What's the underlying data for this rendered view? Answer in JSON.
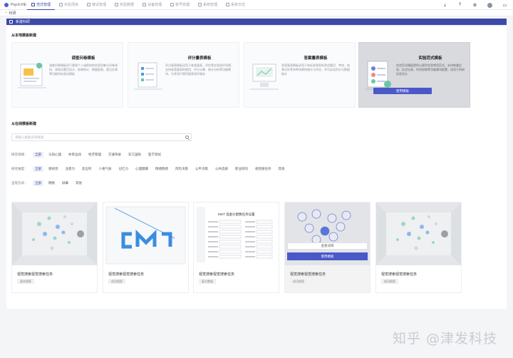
{
  "app": {
    "name": "Psych.HE"
  },
  "nav": [
    {
      "label": "范式管理",
      "active": true
    },
    {
      "label": "实验项目",
      "active": false
    },
    {
      "label": "被试管理",
      "active": false
    },
    {
      "label": "实验数据",
      "active": false
    },
    {
      "label": "设备管理",
      "active": false
    },
    {
      "label": "账号管理",
      "active": false
    },
    {
      "label": "系统管理",
      "active": false
    },
    {
      "label": "系统日志",
      "active": false
    }
  ],
  "breadcrumb": {
    "label": "科研"
  },
  "page_header": {
    "title": "新建科研"
  },
  "local_section": {
    "title": "从本地模板新建"
  },
  "templates": [
    {
      "name": "调查问卷模板",
      "desc": "调查问卷模板用于管理个人或群体的信息采集与问卷调研、表格式题目设计、结果统计、数据报表、意见反馈等功能的标准化模板",
      "button": "",
      "highlight": false
    },
    {
      "name": "评分量表模板",
      "desc": "评分量表模板适用于各类量表、评估等在线测评场景，支持各类量表的使用、评分计算、统计分析等功能模块，为多用户提供量表测评服务",
      "button": "",
      "highlight": false
    },
    {
      "name": "答案量表模板",
      "desc": "答案量表模板适用于有标准答案的测试题目、考核、结果分析等多种场景的统计与评估，并可自动判分与数据统计",
      "button": "",
      "highlight": false
    },
    {
      "name": "实验范式模板",
      "desc": "实验范式模板提供心理学实验常用范式，支持刺激呈现、反应记录、时间控制等功能模块配置，适用于科研实验设计",
      "button": "使用模板",
      "highlight": true
    }
  ],
  "online_section": {
    "title": "从在线模板新建"
  },
  "search": {
    "placeholder": "请输入模板名称搜索"
  },
  "filters": [
    {
      "label": "研究领域：",
      "options": [
        {
          "text": "全部",
          "active": true
        },
        {
          "text": "认知心理",
          "active": false
        },
        {
          "text": "体育运动",
          "active": false
        },
        {
          "text": "经济管理",
          "active": false
        },
        {
          "text": "交通驾驶",
          "active": false
        },
        {
          "text": "军工国防",
          "active": false
        },
        {
          "text": "医学测试",
          "active": false
        }
      ]
    },
    {
      "label": "研究维度：",
      "options": [
        {
          "text": "全部",
          "active": true
        },
        {
          "text": "感知觉",
          "active": false
        },
        {
          "text": "注意力",
          "active": false
        },
        {
          "text": "反应时",
          "active": false
        },
        {
          "text": "人格气质",
          "active": false
        },
        {
          "text": "记忆力",
          "active": false
        },
        {
          "text": "心理健康",
          "active": false
        },
        {
          "text": "情绪情感",
          "active": false
        },
        {
          "text": "风险决策",
          "active": false
        },
        {
          "text": "公平决策",
          "active": false
        },
        {
          "text": "公共选择",
          "active": false
        },
        {
          "text": "职业倾向",
          "active": false
        },
        {
          "text": "视觉搜任务",
          "active": false
        },
        {
          "text": "其他",
          "active": false
        }
      ]
    },
    {
      "label": "呈现方式：",
      "options": [
        {
          "text": "全部",
          "active": true
        },
        {
          "text": "网络",
          "active": false
        },
        {
          "text": "屏幕",
          "active": false
        },
        {
          "text": "其他",
          "active": false
        }
      ]
    }
  ],
  "tasks": [
    {
      "title": "视觉搜索视觉搜索任务",
      "tag": "复杂搜索",
      "thumb": "balls"
    },
    {
      "title": "视觉搜索视觉搜索任务",
      "tag": "成功搜索",
      "thumb": "cm"
    },
    {
      "title": "视觉搜索视觉搜索任务",
      "tag": "复方数据",
      "thumb": "form"
    },
    {
      "title": "视觉搜索视觉搜索任务",
      "tag": "成功搜索",
      "thumb": "circles",
      "view_button": "查看详情",
      "use_button": "使用模板"
    },
    {
      "title": "视觉搜索视觉搜索任务",
      "tag": "成功搜索",
      "thumb": "balls"
    }
  ],
  "form_thumb": {
    "title": "MOT 选金价配数任务设置"
  },
  "watermark": "知乎 @津发科技",
  "colors": {
    "primary": "#3d4aa8",
    "button": "#4a58c8"
  }
}
